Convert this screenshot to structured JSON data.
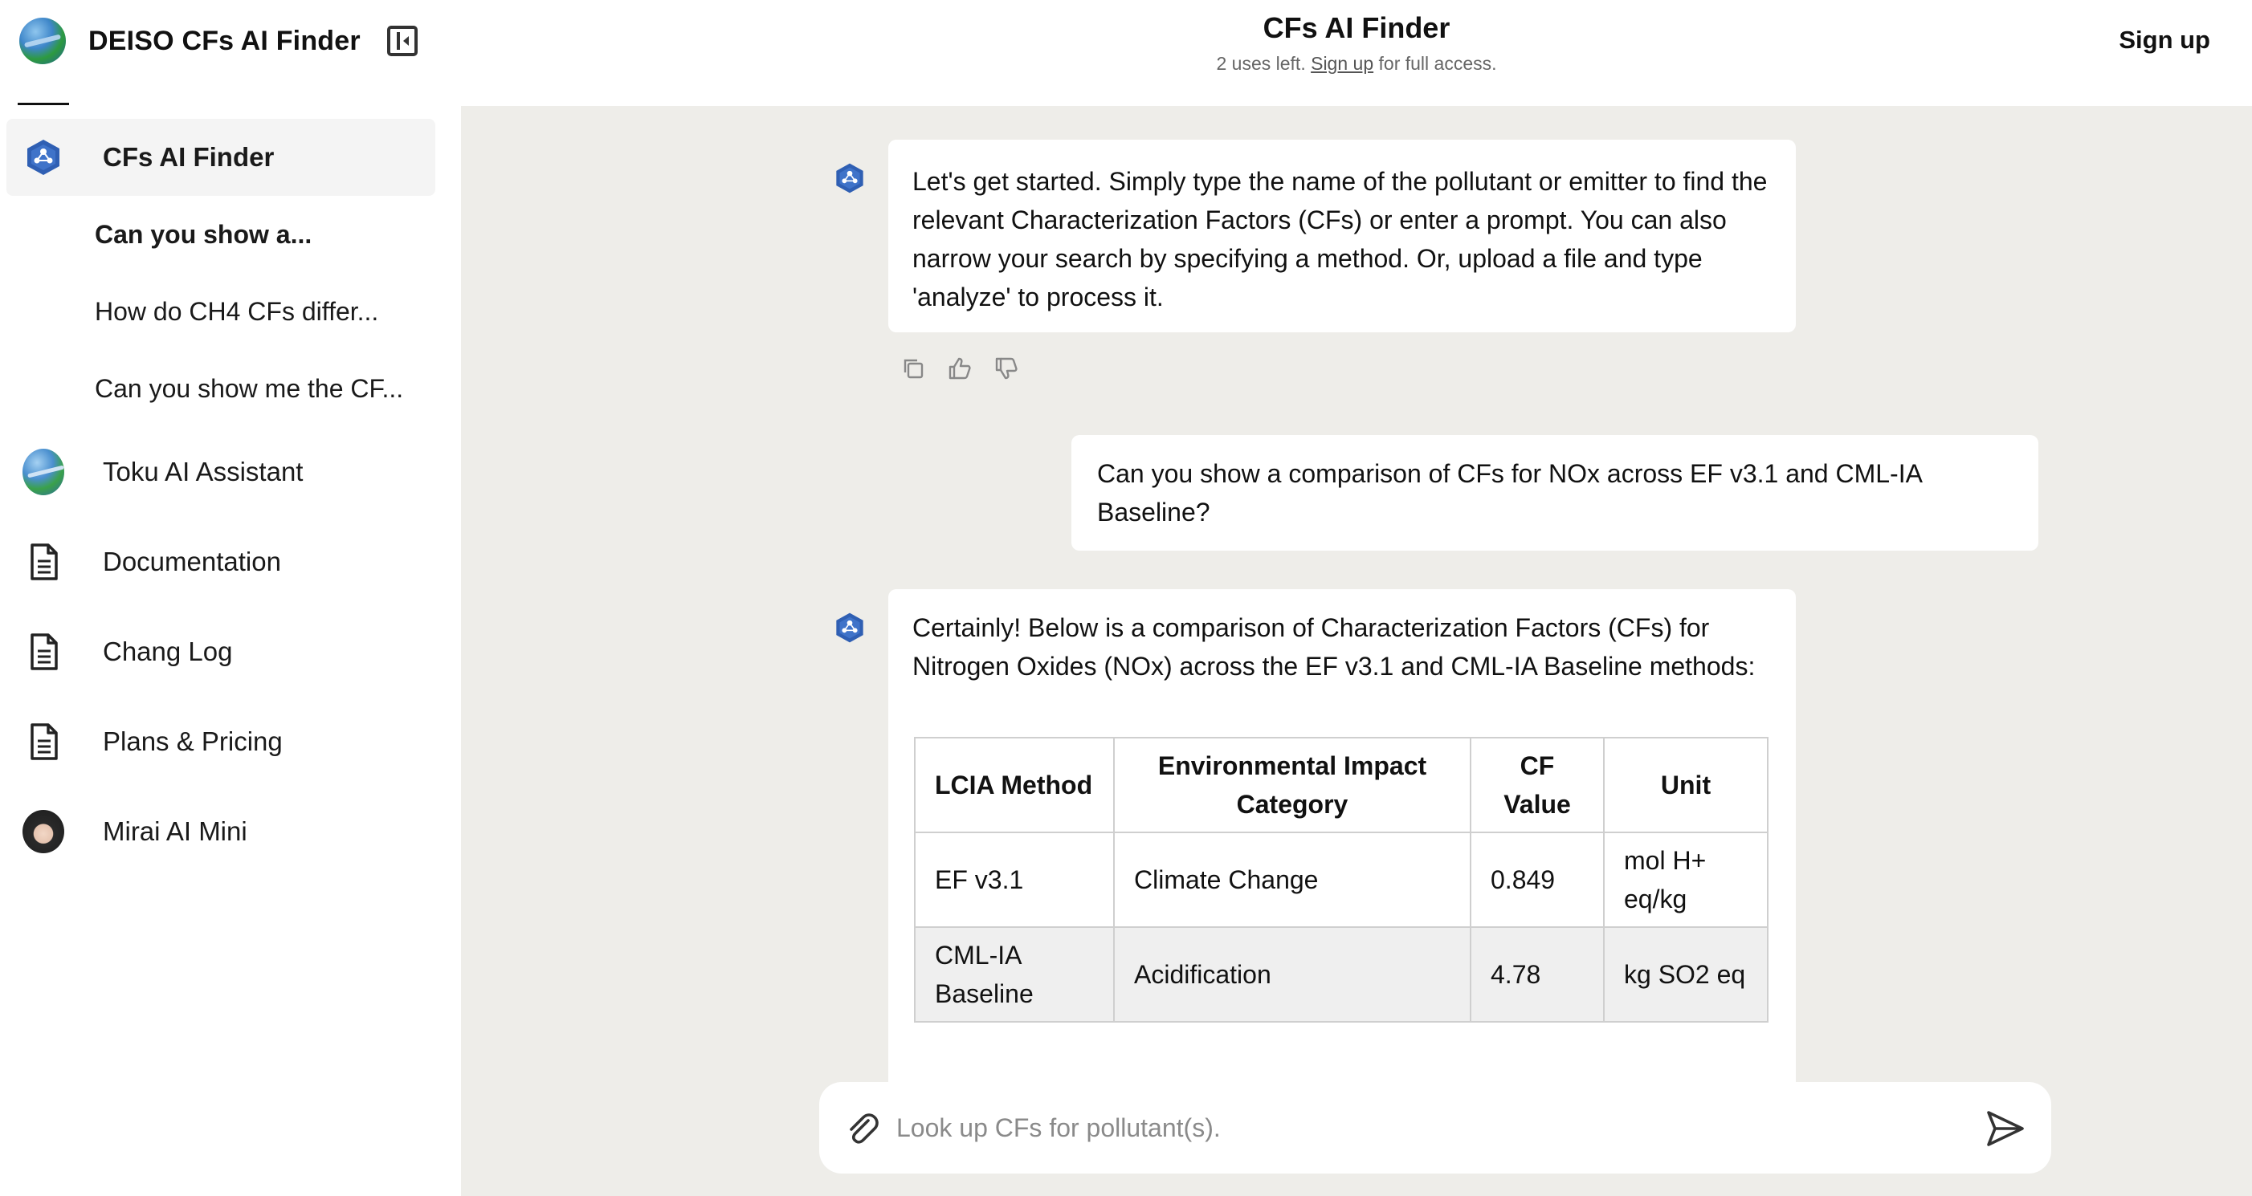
{
  "sidebar": {
    "brand_title": "DEISO CFs AI Finder",
    "items": [
      {
        "label": "CFs AI Finder",
        "icon": "hex-logo-icon",
        "active": true
      },
      {
        "label": "Toku AI Assistant",
        "icon": "globe-avatar-icon"
      },
      {
        "label": "Documentation",
        "icon": "document-icon"
      },
      {
        "label": "Chang Log",
        "icon": "document-icon"
      },
      {
        "label": "Plans & Pricing",
        "icon": "document-icon"
      },
      {
        "label": "Mirai AI Mini",
        "icon": "woman-avatar-icon"
      }
    ],
    "history": [
      {
        "label": "Can you show a...",
        "bold": true
      },
      {
        "label": "How do CH4 CFs differ..."
      },
      {
        "label": "Can you show me the CF..."
      }
    ]
  },
  "header": {
    "title": "CFs AI Finder",
    "uses_prefix": "2 uses left.",
    "uses_link": "Sign up",
    "uses_suffix": "for full access.",
    "signup_label": "Sign up"
  },
  "chat": {
    "message1": "Let's get started. Simply type the name of the pollutant or emitter to find the relevant Characterization Factors (CFs) or enter a prompt. You can also narrow your search by specifying a method. Or, upload a file and type 'analyze' to process it.",
    "user_message": "Can you show a comparison of CFs for NOx across EF v3.1 and CML-IA Baseline?",
    "message2_intro": "Certainly! Below is a comparison of Characterization Factors (CFs) for Nitrogen Oxides (NOx) across the EF v3.1 and CML-IA Baseline methods:",
    "table": {
      "headers": [
        "LCIA Method",
        "Environmental Impact Category",
        "CF Value",
        "Unit"
      ],
      "rows": [
        [
          "EF v3.1",
          "Climate Change",
          "0.849",
          "mol H+ eq/kg"
        ],
        [
          "CML-IA Baseline",
          "Acidification",
          "4.78",
          "kg SO2 eq"
        ]
      ]
    }
  },
  "composer": {
    "placeholder": "Look up CFs for pollutant(s)."
  },
  "colors": {
    "main_bg": "#eeede9",
    "sidebar_active": "#f4f4f4",
    "accent_blue": "#2f5fb3"
  }
}
